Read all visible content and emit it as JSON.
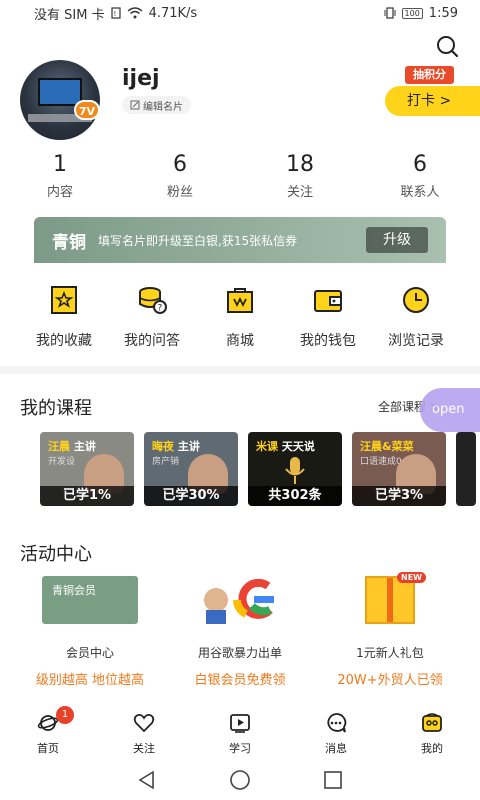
{
  "status_bar": {
    "carrier": "没有 SIM 卡",
    "speed": "4.71K/s",
    "battery": "100",
    "time": "1:59"
  },
  "profile": {
    "username": "ijej",
    "edit_label": "编辑名片",
    "level": "7V",
    "points_label": "抽积分",
    "checkin_label": "打卡 >"
  },
  "stats": [
    {
      "value": "1",
      "label": "内容"
    },
    {
      "value": "6",
      "label": "粉丝"
    },
    {
      "value": "18",
      "label": "关注"
    },
    {
      "value": "6",
      "label": "联系人"
    }
  ],
  "upgrade": {
    "tier": "青铜",
    "text": "填写名片即升级至白银,获15张私信券",
    "button": "升级"
  },
  "quick_menu": [
    {
      "label": "我的收藏",
      "icon": "star-bookmark-icon"
    },
    {
      "label": "我的问答",
      "icon": "coins-question-icon"
    },
    {
      "label": "商城",
      "icon": "shopping-bag-icon"
    },
    {
      "label": "我的钱包",
      "icon": "wallet-icon"
    },
    {
      "label": "浏览记录",
      "icon": "clock-icon"
    }
  ],
  "courses_section": {
    "title": "我的课程",
    "all_label": "全部课程 >",
    "open_label": "open",
    "courses": [
      {
        "title_a": "汪晨",
        "title_b": "主讲",
        "subtitle": "开发设",
        "progress": "已学1%"
      },
      {
        "title_a": "晦夜",
        "title_b": "主讲",
        "subtitle": "房产销",
        "progress": "已学30%"
      },
      {
        "title_a": "米课",
        "title_b": "天天说",
        "subtitle": "",
        "progress": "共302条"
      },
      {
        "title_a": "汪晨&菜菜",
        "title_b": "",
        "subtitle": "口语速成0",
        "progress": "已学3%"
      }
    ]
  },
  "activity_section": {
    "title": "活动中心",
    "items": [
      {
        "card_label": "青铜会员",
        "title": "会员中心",
        "subtitle": "级别越高 地位越高"
      },
      {
        "card_label": "G",
        "title": "用谷歌暴力出单",
        "subtitle": "白银会员免费领"
      },
      {
        "card_label": "NEW",
        "title": "1元新人礼包",
        "subtitle": "20W+外贸人已领"
      }
    ]
  },
  "tabbar": [
    {
      "label": "首页",
      "icon": "planet-icon",
      "badge": "1"
    },
    {
      "label": "关注",
      "icon": "heart-icon"
    },
    {
      "label": "学习",
      "icon": "play-icon"
    },
    {
      "label": "消息",
      "icon": "chat-bubble-icon"
    },
    {
      "label": "我的",
      "icon": "profile-icon"
    }
  ],
  "colors": {
    "accent_yellow": "#ffd31a",
    "accent_orange": "#f07a1c",
    "badge_red": "#e8412a",
    "bronze_green": "#7d9a88"
  }
}
